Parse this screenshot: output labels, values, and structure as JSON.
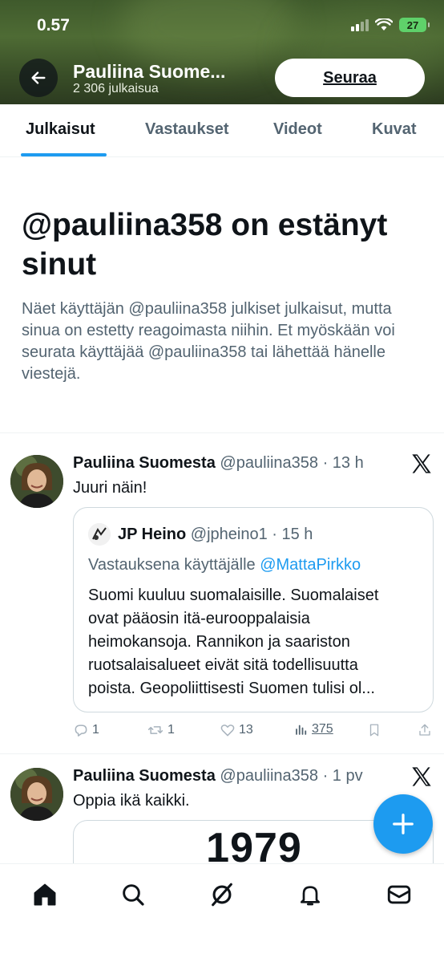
{
  "status_bar": {
    "time": "0.57",
    "battery": "27"
  },
  "profile": {
    "name": "Pauliina Suome...",
    "post_count": "2 306 julkaisua",
    "follow_label": "Seuraa"
  },
  "tabs": [
    {
      "label": "Julkaisut",
      "active": true
    },
    {
      "label": "Vastaukset",
      "active": false
    },
    {
      "label": "Videot",
      "active": false
    },
    {
      "label": "Kuvat",
      "active": false
    }
  ],
  "blocked": {
    "title": "@pauliina358 on estänyt sinut",
    "description": "Näet käyttäjän @pauliina358 julkiset julkaisut, mutta sinua on estetty reagoimasta niihin. Et myöskään voi seurata käyttäjää @pauliina358 tai lähettää hänelle viestejä."
  },
  "posts": [
    {
      "author": "Pauliina Suomesta",
      "meta": "@pauliina358 · 13 h",
      "text": "Juuri näin!",
      "quote": {
        "author": "JP Heino",
        "meta": "@jpheino1 · 15 h",
        "reply_prefix": "Vastauksena käyttäjälle",
        "reply_mention": "@MattaPirkko",
        "lines": [
          "Suomi kuuluu suomalaisille. Suomalaiset",
          "ovat pääosin itä-eurooppalaisia",
          "heimokansoja. Rannikon ja saariston",
          "ruotsalaisalueet eivät sitä todellisuutta",
          "poista. Geopoliittisesti Suomen tulisi ol..."
        ]
      },
      "actions": {
        "replies": "1",
        "reposts": "1",
        "likes": "13",
        "views": "375"
      }
    },
    {
      "author": "Pauliina Suomesta",
      "meta": "@pauliina358 · 1 pv",
      "text": "Oppia ikä kaikki.",
      "media_text": "1979"
    }
  ],
  "icons": {
    "back": "arrow-left-icon",
    "x_logo": "x-logo-icon",
    "compose": "plus-icon",
    "nav": [
      "home-icon",
      "search-icon",
      "grok-icon",
      "bell-icon",
      "mail-icon"
    ]
  },
  "colors": {
    "accent": "#1d9bf0",
    "text": "#0f1419",
    "muted": "#536471"
  }
}
